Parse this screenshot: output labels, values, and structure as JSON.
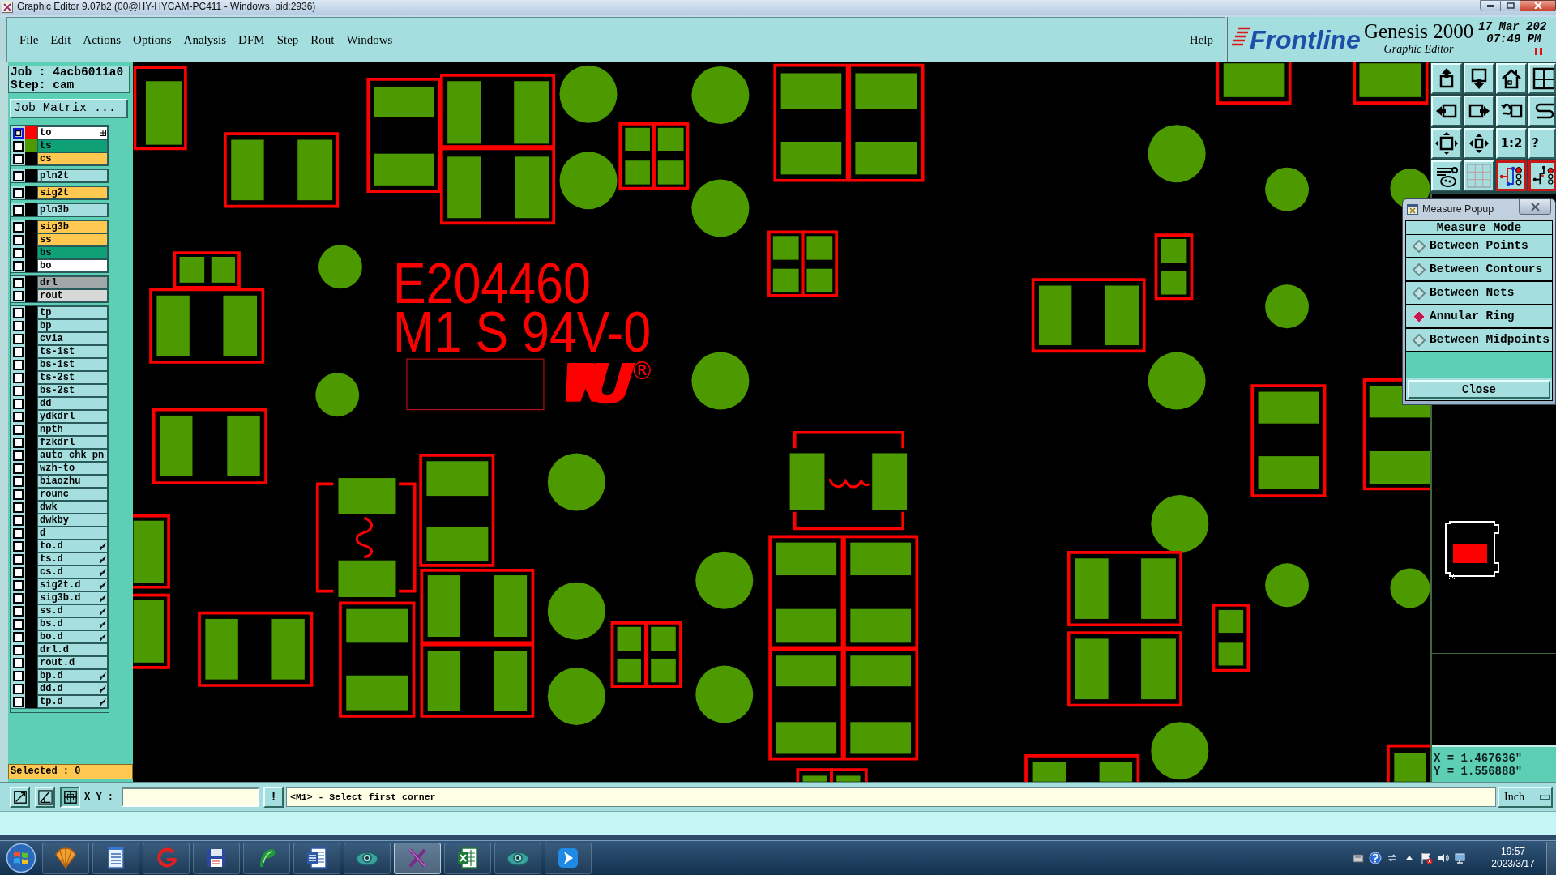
{
  "window": {
    "title": "Graphic Editor 9.07b2 (00@HY-HYCAM-PC411 - Windows, pid:2936)"
  },
  "menu_bar": {
    "items": [
      "File",
      "Edit",
      "Actions",
      "Options",
      "Analysis",
      "DFM",
      "Step",
      "Rout",
      "Windows"
    ],
    "help": "Help"
  },
  "branding": {
    "logo": "Frontline",
    "product": "Genesis 2000",
    "subtitle": "Graphic Editor",
    "date": "17 Mar 202",
    "time": "07:49 PM"
  },
  "job_panel": {
    "job": "Job : 4acb6011a0",
    "step": "Step: cam",
    "matrix_button": "Job Matrix ..."
  },
  "layer_groups": [
    {
      "layers": [
        {
          "name": "to",
          "color": "#ffffff",
          "swatch": {
            "color": "#ff0000"
          },
          "selected": true,
          "kind": "grid"
        },
        {
          "name": "ts",
          "color": "#10a078",
          "swatch": {
            "color": "#4c9a00"
          },
          "selected": false,
          "kind": "plain"
        },
        {
          "name": "cs",
          "color": "#ffc850",
          "selected": false,
          "kind": "plain"
        }
      ]
    },
    {
      "layers": [
        {
          "name": "pln2t",
          "color": "#a4dede",
          "selected": false,
          "kind": "plain"
        }
      ]
    },
    {
      "layers": [
        {
          "name": "sig2t",
          "color": "#ffc850",
          "selected": false,
          "kind": "plain"
        }
      ]
    },
    {
      "layers": [
        {
          "name": "pln3b",
          "color": "#a4dede",
          "selected": false,
          "kind": "plain"
        }
      ]
    },
    {
      "layers": [
        {
          "name": "sig3b",
          "color": "#ffc850",
          "selected": false,
          "kind": "plain"
        },
        {
          "name": "ss",
          "color": "#ffc850",
          "selected": false,
          "kind": "plain"
        },
        {
          "name": "bs",
          "color": "#10a078",
          "selected": false,
          "kind": "plain"
        },
        {
          "name": "bo",
          "color": "#ffffff",
          "selected": false,
          "kind": "plain"
        }
      ]
    },
    {
      "layers": [
        {
          "name": "drl",
          "color": "#a0a8a8",
          "selected": false,
          "kind": "plain"
        },
        {
          "name": "rout",
          "color": "#d8d8d8",
          "selected": false,
          "kind": "plain"
        }
      ]
    },
    {
      "layers": [
        {
          "name": "tp",
          "color": "#a4dede",
          "selected": false,
          "kind": "plain"
        },
        {
          "name": "bp",
          "color": "#a4dede",
          "selected": false,
          "kind": "plain"
        },
        {
          "name": "cvia",
          "color": "#a4dede",
          "selected": false,
          "kind": "plain"
        },
        {
          "name": "ts-1st",
          "color": "#a4dede",
          "selected": false,
          "kind": "plain"
        },
        {
          "name": "bs-1st",
          "color": "#a4dede",
          "selected": false,
          "kind": "plain"
        },
        {
          "name": "ts-2st",
          "color": "#a4dede",
          "selected": false,
          "kind": "plain"
        },
        {
          "name": "bs-2st",
          "color": "#a4dede",
          "selected": false,
          "kind": "plain"
        },
        {
          "name": "dd",
          "color": "#a4dede",
          "selected": false,
          "kind": "plain"
        },
        {
          "name": "ydkdrl",
          "color": "#a4dede",
          "selected": false,
          "kind": "plain"
        },
        {
          "name": "npth",
          "color": "#a4dede",
          "selected": false,
          "kind": "plain"
        },
        {
          "name": "fzkdrl",
          "color": "#a4dede",
          "selected": false,
          "kind": "plain"
        },
        {
          "name": "auto_chk_pn",
          "color": "#a4dede",
          "selected": false,
          "kind": "plain"
        },
        {
          "name": "wzh-to",
          "color": "#a4dede",
          "selected": false,
          "kind": "plain"
        },
        {
          "name": "biaozhu",
          "color": "#a4dede",
          "selected": false,
          "kind": "plain"
        },
        {
          "name": "rounc",
          "color": "#a4dede",
          "selected": false,
          "kind": "plain"
        },
        {
          "name": "dwk",
          "color": "#a4dede",
          "selected": false,
          "kind": "plain"
        },
        {
          "name": "dwkby",
          "color": "#a4dede",
          "selected": false,
          "kind": "plain"
        },
        {
          "name": "d",
          "color": "#a4dede",
          "selected": false,
          "kind": "plain"
        },
        {
          "name": "to.d",
          "color": "#a4dede",
          "selected": false,
          "kind": "pen"
        },
        {
          "name": "ts.d",
          "color": "#a4dede",
          "selected": false,
          "kind": "pen"
        },
        {
          "name": "cs.d",
          "color": "#a4dede",
          "selected": false,
          "kind": "pen"
        },
        {
          "name": "sig2t.d",
          "color": "#a4dede",
          "selected": false,
          "kind": "pen"
        },
        {
          "name": "sig3b.d",
          "color": "#a4dede",
          "selected": false,
          "kind": "pen"
        },
        {
          "name": "ss.d",
          "color": "#a4dede",
          "selected": false,
          "kind": "pen"
        },
        {
          "name": "bs.d",
          "color": "#a4dede",
          "selected": false,
          "kind": "pen"
        },
        {
          "name": "bo.d",
          "color": "#a4dede",
          "selected": false,
          "kind": "pen"
        },
        {
          "name": "drl.d",
          "color": "#a4dede",
          "selected": false,
          "kind": "plain"
        },
        {
          "name": "rout.d",
          "color": "#a4dede",
          "selected": false,
          "kind": "plain"
        },
        {
          "name": "bp.d",
          "color": "#a4dede",
          "selected": false,
          "kind": "pen"
        },
        {
          "name": "dd.d",
          "color": "#a4dede",
          "selected": false,
          "kind": "pen"
        },
        {
          "name": "tp.d",
          "color": "#a4dede",
          "selected": false,
          "kind": "pen"
        }
      ]
    }
  ],
  "selected_count": "Selected : 0",
  "canvas": {
    "markings": [
      "E204460",
      "M1 S 94V-0"
    ],
    "registered_mark": "®"
  },
  "toolbar": {
    "buttons": [
      {
        "kind": "icon",
        "on": false
      },
      {
        "kind": "icon",
        "on": false
      },
      {
        "kind": "icon",
        "on": false
      },
      {
        "kind": "icon",
        "on": false
      },
      {
        "kind": "icon",
        "on": false
      },
      {
        "kind": "icon",
        "on": false
      },
      {
        "kind": "icon",
        "on": false
      },
      {
        "kind": "icon",
        "on": false
      },
      {
        "kind": "icon",
        "on": false
      },
      {
        "kind": "icon",
        "on": false
      },
      {
        "kind": "text",
        "label": "1:2",
        "on": false
      },
      {
        "kind": "text",
        "label": "?",
        "on": false
      },
      {
        "kind": "icon",
        "on": false
      },
      {
        "kind": "icon",
        "on": false
      },
      {
        "kind": "icon",
        "on": true
      },
      {
        "kind": "icon",
        "on": true
      }
    ]
  },
  "measure_popup": {
    "title": "Measure Popup",
    "heading": "Measure Mode",
    "modes": [
      {
        "label": "Between Points",
        "selected": false
      },
      {
        "label": "Between Contours",
        "selected": false
      },
      {
        "label": "Between Nets",
        "selected": false
      },
      {
        "label": "Annular Ring",
        "selected": true
      },
      {
        "label": "Between Midpoints",
        "selected": false
      }
    ],
    "close_button": "Close"
  },
  "coordinates": {
    "x": "X = 1.467636\"",
    "y": "Y = 1.556888\""
  },
  "command_bar": {
    "xy_label": "X Y :",
    "action_button": "!",
    "prompt": "<M1> - Select first corner",
    "units": "Inch"
  },
  "taskbar": {
    "apps": [
      {
        "selected": false
      },
      {
        "selected": false
      },
      {
        "selected": false
      },
      {
        "selected": false
      },
      {
        "selected": false
      },
      {
        "selected": false
      },
      {
        "selected": false
      },
      {
        "selected": true
      },
      {
        "selected": false
      },
      {
        "selected": false
      },
      {
        "selected": false
      }
    ],
    "time": "19:57",
    "date": "2023/3/17"
  }
}
